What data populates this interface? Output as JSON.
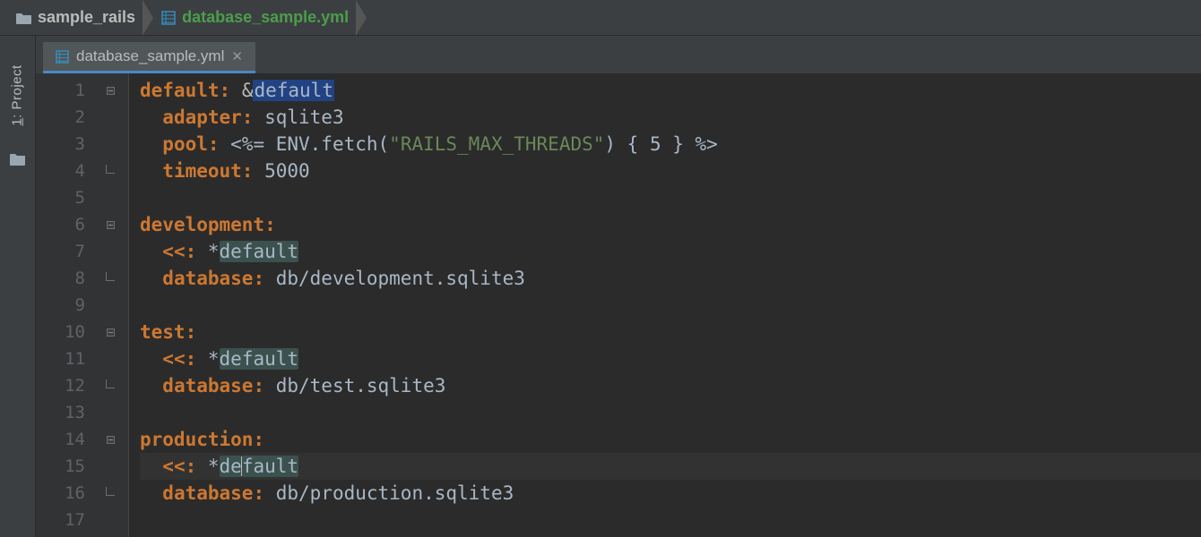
{
  "breadcrumb": {
    "folder": "sample_rails",
    "file": "database_sample.yml"
  },
  "sidebar": {
    "project_label_num": "1",
    "project_label_text": ": Project"
  },
  "tab": {
    "filename": "database_sample.yml"
  },
  "code": {
    "lines": [
      {
        "n": "1",
        "fold": "minus",
        "tokens": [
          {
            "t": "key",
            "v": "default:"
          },
          {
            "t": "val",
            "v": " "
          },
          {
            "t": "anchor",
            "v": "&"
          },
          {
            "t": "anchor-hl",
            "v": "default"
          }
        ]
      },
      {
        "n": "2",
        "tokens": [
          {
            "t": "val",
            "v": "  "
          },
          {
            "t": "key",
            "v": "adapter:"
          },
          {
            "t": "val",
            "v": " sqlite3"
          }
        ]
      },
      {
        "n": "3",
        "tokens": [
          {
            "t": "val",
            "v": "  "
          },
          {
            "t": "key",
            "v": "pool:"
          },
          {
            "t": "val",
            "v": " <%= ENV.fetch("
          },
          {
            "t": "str",
            "v": "\"RAILS_MAX_THREADS\""
          },
          {
            "t": "val",
            "v": ") { 5 } %>"
          }
        ]
      },
      {
        "n": "4",
        "fold": "end",
        "tokens": [
          {
            "t": "val",
            "v": "  "
          },
          {
            "t": "key",
            "v": "timeout:"
          },
          {
            "t": "val",
            "v": " 5000"
          }
        ]
      },
      {
        "n": "5",
        "tokens": []
      },
      {
        "n": "6",
        "fold": "minus",
        "tokens": [
          {
            "t": "key",
            "v": "development:"
          }
        ]
      },
      {
        "n": "7",
        "tokens": [
          {
            "t": "val",
            "v": "  "
          },
          {
            "t": "merge",
            "v": "<<:"
          },
          {
            "t": "val",
            "v": " *"
          },
          {
            "t": "ref-hl",
            "v": "default"
          }
        ]
      },
      {
        "n": "8",
        "fold": "end",
        "tokens": [
          {
            "t": "val",
            "v": "  "
          },
          {
            "t": "key",
            "v": "database:"
          },
          {
            "t": "val",
            "v": " db/development.sqlite3"
          }
        ]
      },
      {
        "n": "9",
        "tokens": []
      },
      {
        "n": "10",
        "fold": "minus",
        "tokens": [
          {
            "t": "key",
            "v": "test:"
          }
        ]
      },
      {
        "n": "11",
        "tokens": [
          {
            "t": "val",
            "v": "  "
          },
          {
            "t": "merge",
            "v": "<<:"
          },
          {
            "t": "val",
            "v": " *"
          },
          {
            "t": "ref-hl",
            "v": "default"
          }
        ]
      },
      {
        "n": "12",
        "fold": "end",
        "tokens": [
          {
            "t": "val",
            "v": "  "
          },
          {
            "t": "key",
            "v": "database:"
          },
          {
            "t": "val",
            "v": " db/test.sqlite3"
          }
        ]
      },
      {
        "n": "13",
        "tokens": []
      },
      {
        "n": "14",
        "fold": "minus",
        "tokens": [
          {
            "t": "key",
            "v": "production:"
          }
        ]
      },
      {
        "n": "15",
        "hl": true,
        "tokens": [
          {
            "t": "val",
            "v": "  "
          },
          {
            "t": "merge",
            "v": "<<:"
          },
          {
            "t": "val",
            "v": " *"
          },
          {
            "t": "ref-hl",
            "v": "de"
          },
          {
            "t": "caret",
            "v": ""
          },
          {
            "t": "ref-hl",
            "v": "fault"
          }
        ]
      },
      {
        "n": "16",
        "fold": "end",
        "tokens": [
          {
            "t": "val",
            "v": "  "
          },
          {
            "t": "key",
            "v": "database:"
          },
          {
            "t": "val",
            "v": " db/production.sqlite3"
          }
        ]
      },
      {
        "n": "17",
        "tokens": []
      }
    ]
  }
}
